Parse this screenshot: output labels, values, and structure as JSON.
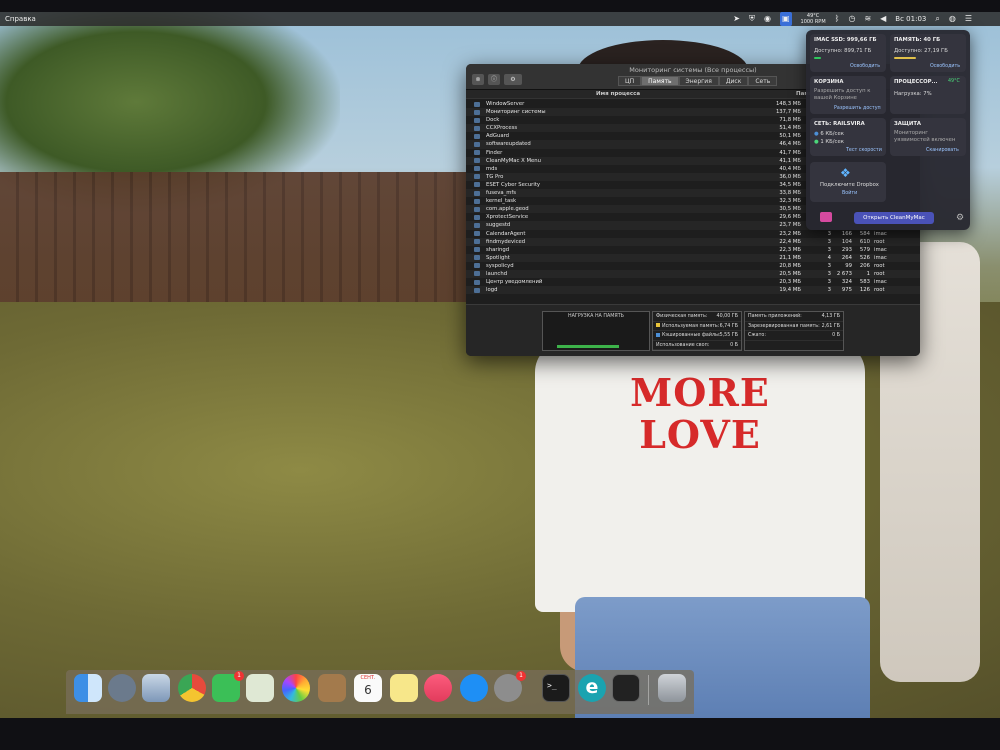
{
  "menubar": {
    "left_menu": "Справка",
    "cpu_temp": "49°C",
    "fan_rpm": "1000 RPM",
    "clock": "Вс 01:03"
  },
  "activity_monitor": {
    "title": "Мониторинг системы (Все процессы)",
    "tabs": [
      {
        "label": "ЦП",
        "active": false
      },
      {
        "label": "Память",
        "active": true
      },
      {
        "label": "Энергия",
        "active": false
      },
      {
        "label": "Диск",
        "active": false
      },
      {
        "label": "Сеть",
        "active": false
      }
    ],
    "columns": {
      "name": "Имя процесса",
      "memory": "Память ⌄"
    },
    "processes": [
      {
        "name": "WindowServer",
        "mem": "148,3 МБ",
        "c1": "",
        "c2": "",
        "c3": "",
        "user": ""
      },
      {
        "name": "Мониторинг системы",
        "mem": "137,7 МБ",
        "c1": "",
        "c2": "",
        "c3": "",
        "user": ""
      },
      {
        "name": "Dock",
        "mem": "71,8 МБ",
        "c1": "",
        "c2": "",
        "c3": "",
        "user": ""
      },
      {
        "name": "CCXProcess",
        "mem": "51,4 МБ",
        "c1": "",
        "c2": "",
        "c3": "",
        "user": ""
      },
      {
        "name": "AdGuard",
        "mem": "50,1 МБ",
        "c1": "",
        "c2": "",
        "c3": "",
        "user": ""
      },
      {
        "name": "softwareupdated",
        "mem": "46,4 МБ",
        "c1": "",
        "c2": "",
        "c3": "",
        "user": ""
      },
      {
        "name": "Finder",
        "mem": "41,7 МБ",
        "c1": "",
        "c2": "",
        "c3": "",
        "user": ""
      },
      {
        "name": "CleanMyMac X Menu",
        "mem": "41,1 МБ",
        "c1": "",
        "c2": "",
        "c3": "",
        "user": ""
      },
      {
        "name": "mds",
        "mem": "40,4 МБ",
        "c1": "",
        "c2": "",
        "c3": "",
        "user": ""
      },
      {
        "name": "TG Pro",
        "mem": "36,0 МБ",
        "c1": "",
        "c2": "",
        "c3": "",
        "user": ""
      },
      {
        "name": "ESET Cyber Security",
        "mem": "34,5 МБ",
        "c1": "",
        "c2": "",
        "c3": "",
        "user": ""
      },
      {
        "name": "fuseva_mfs",
        "mem": "33,8 МБ",
        "c1": "",
        "c2": "",
        "c3": "",
        "user": ""
      },
      {
        "name": "kernel_task",
        "mem": "32,3 МБ",
        "c1": "",
        "c2": "",
        "c3": "",
        "user": ""
      },
      {
        "name": "com.apple.geod",
        "mem": "30,5 МБ",
        "c1": "",
        "c2": "",
        "c3": "",
        "user": ""
      },
      {
        "name": "XprotectService",
        "mem": "29,6 МБ",
        "c1": "",
        "c2": "",
        "c3": "",
        "user": ""
      },
      {
        "name": "suggestd",
        "mem": "23,7 МБ",
        "c1": "",
        "c2": "",
        "c3": "",
        "user": ""
      },
      {
        "name": "CalendarAgent",
        "mem": "23,2 МБ",
        "c1": "3",
        "c2": "166",
        "c3": "584",
        "user": "imac"
      },
      {
        "name": "findmydeviced",
        "mem": "22,4 МБ",
        "c1": "3",
        "c2": "104",
        "c3": "610",
        "user": "root"
      },
      {
        "name": "sharingd",
        "mem": "22,3 МБ",
        "c1": "3",
        "c2": "293",
        "c3": "579",
        "user": "imac"
      },
      {
        "name": "Spotlight",
        "mem": "21,1 МБ",
        "c1": "4",
        "c2": "264",
        "c3": "526",
        "user": "imac"
      },
      {
        "name": "syspolicyd",
        "mem": "20,8 МБ",
        "c1": "3",
        "c2": "99",
        "c3": "206",
        "user": "root"
      },
      {
        "name": "launchd",
        "mem": "20,5 МБ",
        "c1": "3",
        "c2": "2 673",
        "c3": "1",
        "user": "root"
      },
      {
        "name": "Центр уведомлений",
        "mem": "20,3 МБ",
        "c1": "3",
        "c2": "324",
        "c3": "583",
        "user": "imac"
      },
      {
        "name": "logd",
        "mem": "19,4 МБ",
        "c1": "3",
        "c2": "975",
        "c3": "126",
        "user": "root"
      }
    ],
    "memory_pressure": {
      "label": "НАГРУЗКА НА ПАМЯТЬ",
      "level": 0.78
    },
    "stats_left": [
      {
        "label": "Физическая память:",
        "value": "40,00 ГБ",
        "swatch": ""
      },
      {
        "label": "Используемая память:",
        "value": "6,74 ГБ",
        "swatch": "#e8c33a"
      },
      {
        "label": "Кэшированные файлы:",
        "value": "5,55 ГБ",
        "swatch": "#4c8fd6"
      },
      {
        "label": "Использование своп:",
        "value": "0 Б",
        "swatch": ""
      }
    ],
    "stats_right": [
      {
        "label": "Память приложений:",
        "value": "4,13 ГБ"
      },
      {
        "label": "Зарезервированная память:",
        "value": "2,61 ГБ"
      },
      {
        "label": "Сжато:",
        "value": "0 Б"
      }
    ]
  },
  "cleanmymac": {
    "disk_title": "IMAC SSD: 999,66 ГБ",
    "disk_free": "Доступно: 899,71 ГБ",
    "disk_action": "Освободить",
    "disk_level": 0.1,
    "mem_title": "ПАМЯТЬ: 40 ГБ",
    "mem_free": "Доступно: 27,19 ГБ",
    "mem_action": "Освободить",
    "mem_level": 0.32,
    "trash_title": "КОРЗИНА",
    "trash_text": "Разрешить доступ к вашей Корзине",
    "trash_action": "Разрешить доступ",
    "cpu_title": "ПРОЦЕССОР...",
    "cpu_temp": "49°C",
    "cpu_load": "Нагрузка: 7%",
    "net_title": "СЕТЬ: RAILSVIRA",
    "net_up": "6 КБ/сек",
    "net_down": "1 КБ/сек",
    "net_action": "Тест скорости",
    "protect_title": "ЗАЩИТА",
    "protect_text": "Мониторинг уязвимостей включен",
    "protect_action": "Сканировать",
    "dropbox_text": "Подключите Dropbox",
    "dropbox_action": "Войти",
    "open_button": "Открыть CleanMyMac"
  },
  "wallpaper": {
    "shirt_line1": "MORE",
    "shirt_line2": "LOVE"
  },
  "dock": {
    "mail_badge": "1",
    "prefs_badge": "1",
    "calendar_month": "СЕНТ.",
    "calendar_day": "6",
    "terminal_prompt": ">_",
    "eset_letter": "e"
  }
}
